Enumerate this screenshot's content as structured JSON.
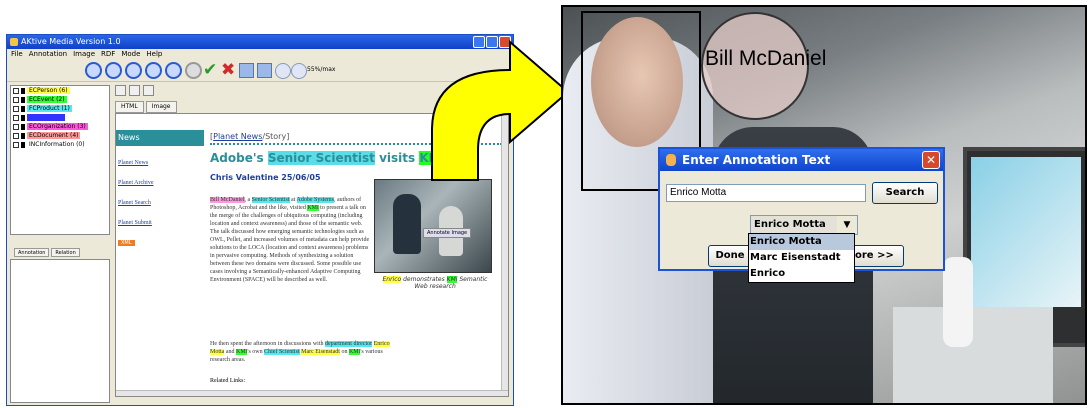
{
  "window": {
    "title": "AKtive Media Version 1.0",
    "menu": [
      "File",
      "Annotation",
      "Image",
      "RDF",
      "Mode",
      "Help"
    ],
    "zoom_label": "55%/max"
  },
  "tree": {
    "items": [
      {
        "label": "ECPerson (6)",
        "color": "#ffff44"
      },
      {
        "label": "ECEvent (2)",
        "color": "#33ff33"
      },
      {
        "label": "FCProduct (1)",
        "color": "#55e8ee"
      },
      {
        "label": "",
        "color": "#3333ff"
      },
      {
        "label": "ECOrganization (3)",
        "color": "#ff55dd"
      },
      {
        "label": "ECDocument (4)",
        "color": "#ff9999"
      },
      {
        "label": "INCInformation (0)",
        "color": "#ffffff"
      }
    ]
  },
  "left_tabs": [
    "Annotation",
    "Relation"
  ],
  "content_tabs": [
    "HTML",
    "Image"
  ],
  "web": {
    "nav_title": "News",
    "nav_links": [
      "Planet News",
      "Planet Archive",
      "Planet Search",
      "Planet Submit"
    ],
    "xml_badge": "XML",
    "crumb_link": "Planet News",
    "crumb_rest": "/Story]",
    "headline_pre": "Adobe's ",
    "headline_hl": "Senior Scientist",
    "headline_mid": " visits ",
    "headline_kmi": "KMi",
    "author": "Chris Valentine 25/06/05",
    "para1_a": "Bill McDaniel",
    "para1_b": ", a ",
    "para1_c": "Senior Scientist",
    "para1_d": " at ",
    "para1_e": "Adobe Systems",
    "para1_f": ", authors of Photoshop, Acrobat and the like, visited ",
    "para1_g": "KMi",
    "para1_h": " to present a talk on the merge of the challenges of ubiquitous computing (including location and context awareness) and those of the semantic web. The talk discussed how emerging semantic technologies such as OWL, Pellet, and increased volumes of metadata can help provide solutions to the LOCA (location and context awareness) problems in pervasive computing. Methods of synthesizing a solution between these two domains were discussed. Some possible use cases involving a Semantically-enhanced Adaptive Computing Environment (SPACE) will be described as well.",
    "para2_a": "He then spent the afternoon in discussions with ",
    "para2_b": "department director",
    "para2_c": " ",
    "para2_d": "Enrico Motta",
    "para2_e": " and ",
    "para2_f": "KMi",
    "para2_g": "'s own ",
    "para2_h": "Chief Scientist",
    "para2_i": " ",
    "para2_j": "Marc Eisenstadt",
    "para2_k": " on ",
    "para2_l": "KMi",
    "para2_m": "'s various research areas.",
    "related": "Related Links:",
    "annotate_button": "Annotate Image",
    "caption_a": "Enrico",
    "caption_b": " demonstrates ",
    "caption_c": "KMi",
    "caption_d": " Semantic Web research"
  },
  "photo": {
    "name_label": "Bill McDaniel"
  },
  "dialog": {
    "title": "Enter Annotation Text",
    "input_value": "Enrico Motta",
    "search_label": "Search",
    "selected": "Enrico Motta",
    "done_label": "Done",
    "more_label": "ore >>",
    "options": [
      "Enrico Motta",
      "Marc Eisenstadt",
      "Enrico"
    ]
  },
  "colors": {
    "accent": "#2b8f9a",
    "arrow": "#ffff00"
  }
}
